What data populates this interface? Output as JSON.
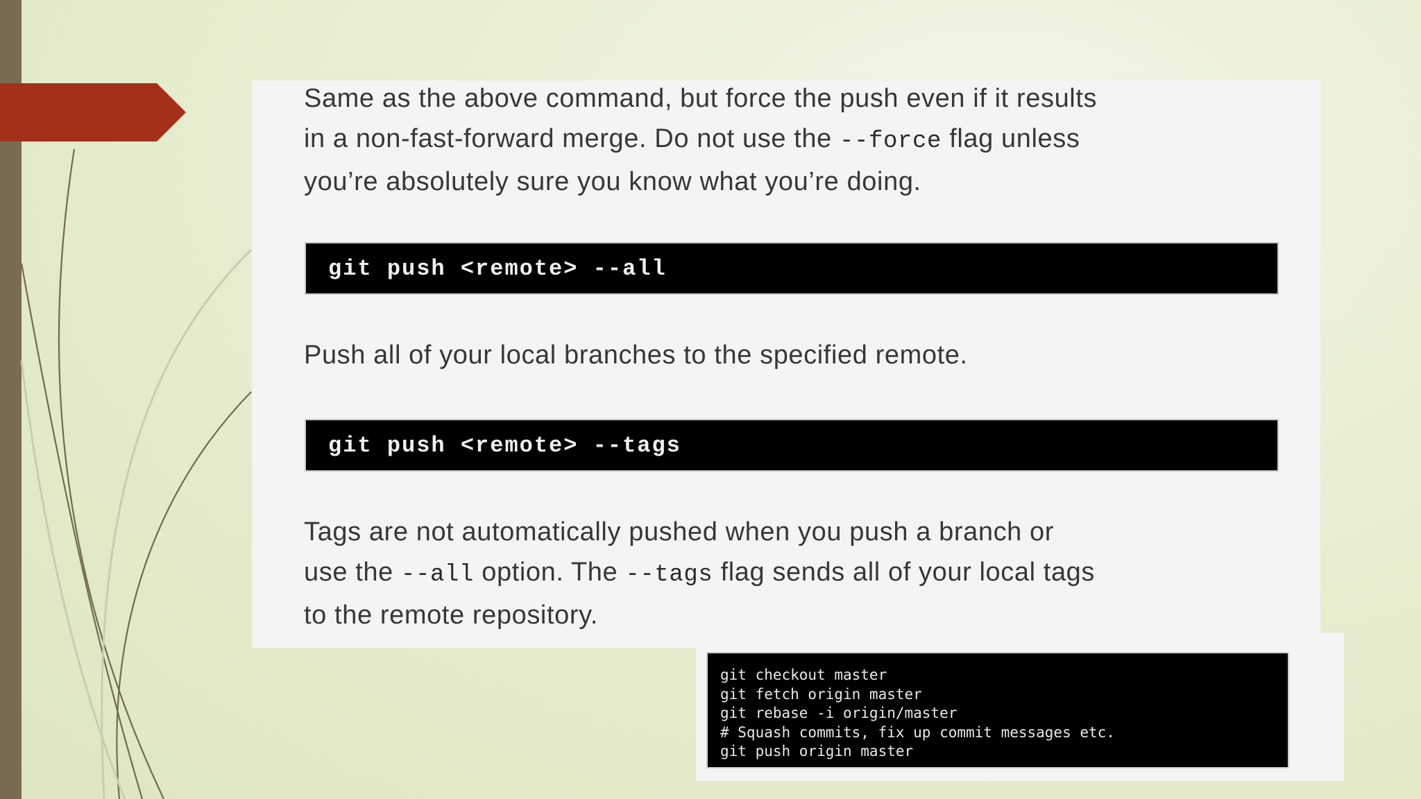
{
  "para1": {
    "l1": "Same as the above command, but force the push even if it results",
    "l2a": "in a non-fast-forward merge. Do not use the ",
    "l2code": "--force",
    "l2b": " flag unless",
    "l3": "you’re absolutely sure you know what you’re doing."
  },
  "code1": "git push <remote> --all",
  "para2": "Push all of your local branches to the specified remote.",
  "code2": "git push <remote> --tags",
  "para3": {
    "l1": "Tags are not automatically pushed when you push a branch or",
    "l2a": "use the ",
    "l2code1": "--all",
    "l2b": " option. The ",
    "l2code2": "--tags",
    "l2c": " flag sends all of your local tags",
    "l3": "to the remote repository."
  },
  "terminal": {
    "lines": [
      "git checkout master",
      "git fetch origin master",
      "git rebase -i origin/master",
      "# Squash commits, fix up commit messages etc.",
      "git push origin master"
    ]
  },
  "colors": {
    "ribbon": "#a3311a",
    "left_bar": "#786d52",
    "code_bg": "#000000"
  }
}
